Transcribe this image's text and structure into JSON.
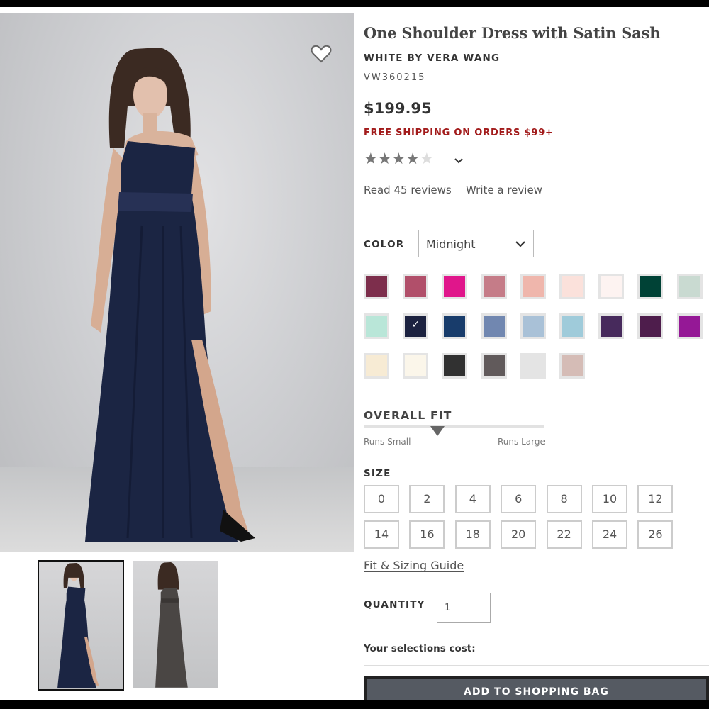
{
  "product": {
    "title": "One Shoulder Dress with Satin Sash",
    "brand": "WHITE BY VERA WANG",
    "sku": "VW360215",
    "price": "$199.95",
    "shipping_promo": "FREE SHIPPING ON ORDERS $99+",
    "rating": {
      "stars": 4,
      "max": 5
    },
    "reviews_link": "Read 45 reviews",
    "write_review_link": "Write a review"
  },
  "color": {
    "label": "COLOR",
    "selected": "Midnight",
    "swatches": [
      [
        "#7d2e4c",
        "#b14f6a",
        "#e0168b",
        "#c57c88",
        "#efb6ac",
        "#fbe1db",
        "#fdf3f1",
        "#004236",
        "#c9dad1"
      ],
      [
        "#b9e6d8",
        "#1c2240",
        "#183c6b",
        "#7187b0",
        "#a9c1d7",
        "#9fcbda",
        "#472a5c",
        "#4e1d4c",
        "#951896"
      ],
      [
        "#f7ebd4",
        "#fbf6ea",
        "#313131",
        "#615a5b",
        "#e4e4e4",
        "#d5bcb6"
      ]
    ],
    "selected_index": [
      1,
      1
    ]
  },
  "fit": {
    "label": "OVERALL FIT",
    "runs_small": "Runs Small",
    "runs_large": "Runs Large",
    "position": 0.41
  },
  "size": {
    "label": "SIZE",
    "rows": [
      [
        "0",
        "2",
        "4",
        "6",
        "8",
        "10",
        "12"
      ],
      [
        "14",
        "16",
        "18",
        "20",
        "22",
        "24",
        "26"
      ]
    ],
    "guide_link": "Fit & Sizing Guide"
  },
  "quantity": {
    "label": "QUANTITY",
    "value": "1"
  },
  "cost_label": "Your selections cost:",
  "add_to_bag": "ADD TO SHOPPING BAG",
  "colors": {
    "dress": "#1b2543",
    "promo": "#a21b1b",
    "button": "#555a62"
  }
}
